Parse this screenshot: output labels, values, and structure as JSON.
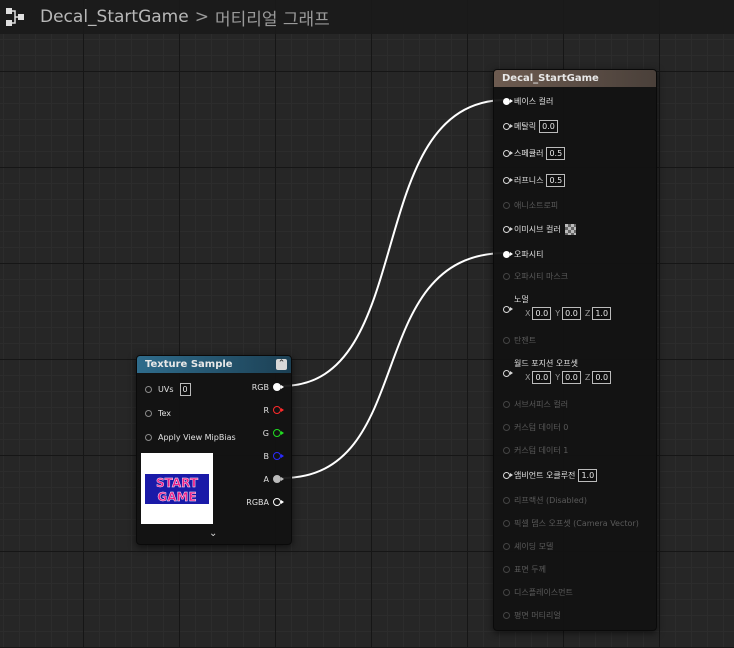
{
  "breadcrumb": {
    "asset": "Decal_StartGame",
    "separator": ">",
    "current": "머티리얼 그래프"
  },
  "material_node": {
    "title": "Decal_StartGame",
    "pins": [
      {
        "label": "베이스 컬러",
        "connected": true
      },
      {
        "label": "메탈릭",
        "value": "0.0"
      },
      {
        "label": "스페큘러",
        "value": "0.5"
      },
      {
        "label": "러프니스",
        "value": "0.5"
      },
      {
        "label": "애니소트로피",
        "disabled": true
      },
      {
        "label": "이미시브 컬러",
        "icon": "checker-swatch"
      },
      {
        "label": "오파시티",
        "connected": true
      },
      {
        "label": "오파시티 마스크",
        "disabled": true
      },
      {
        "label": "노멀",
        "vector": {
          "x": "0.0",
          "y": "0.0",
          "z": "1.0"
        }
      },
      {
        "label": "탄젠트",
        "disabled": true
      },
      {
        "label": "월드 포지션 오프셋",
        "vector": {
          "x": "0.0",
          "y": "0.0",
          "z": "0.0"
        }
      },
      {
        "label": "서브서피스 컬러",
        "disabled": true
      },
      {
        "label": "커스텀 데이터 0",
        "disabled": true
      },
      {
        "label": "커스텀 데이터 1",
        "disabled": true
      },
      {
        "label": "앰비언트 오클루전",
        "value": "1.0"
      },
      {
        "label": "리프랙션 (Disabled)",
        "disabled": true
      },
      {
        "label": "픽셀 뎁스 오프셋 (Camera Vector)",
        "disabled": true
      },
      {
        "label": "셰이딩 모델",
        "disabled": true
      },
      {
        "label": "표면 두께",
        "disabled": true
      },
      {
        "label": "디스플레이스먼트",
        "disabled": true
      },
      {
        "label": "평면 머티리얼",
        "disabled": true
      }
    ]
  },
  "texture_node": {
    "title": "Texture Sample",
    "inputs": [
      {
        "label": "UVs",
        "value": "0"
      },
      {
        "label": "Tex"
      },
      {
        "label": "Apply View MipBias"
      }
    ],
    "outputs": [
      {
        "label": "RGB",
        "color": "#ffffff",
        "connected": true
      },
      {
        "label": "R",
        "color": "#ff2a2a"
      },
      {
        "label": "G",
        "color": "#22dd22"
      },
      {
        "label": "B",
        "color": "#2a2aff"
      },
      {
        "label": "A",
        "color": "#bbbbbb",
        "connected": true
      },
      {
        "label": "RGBA",
        "color": "#ffffff"
      }
    ],
    "preview_text": [
      "START",
      "GAME"
    ]
  },
  "colors": {
    "wire": "#ffffff",
    "material_header": "#6d5b50",
    "texture_header": "#2f6c8c",
    "preview_text": "#e8208a",
    "preview_bg": "#1a1aa8"
  }
}
